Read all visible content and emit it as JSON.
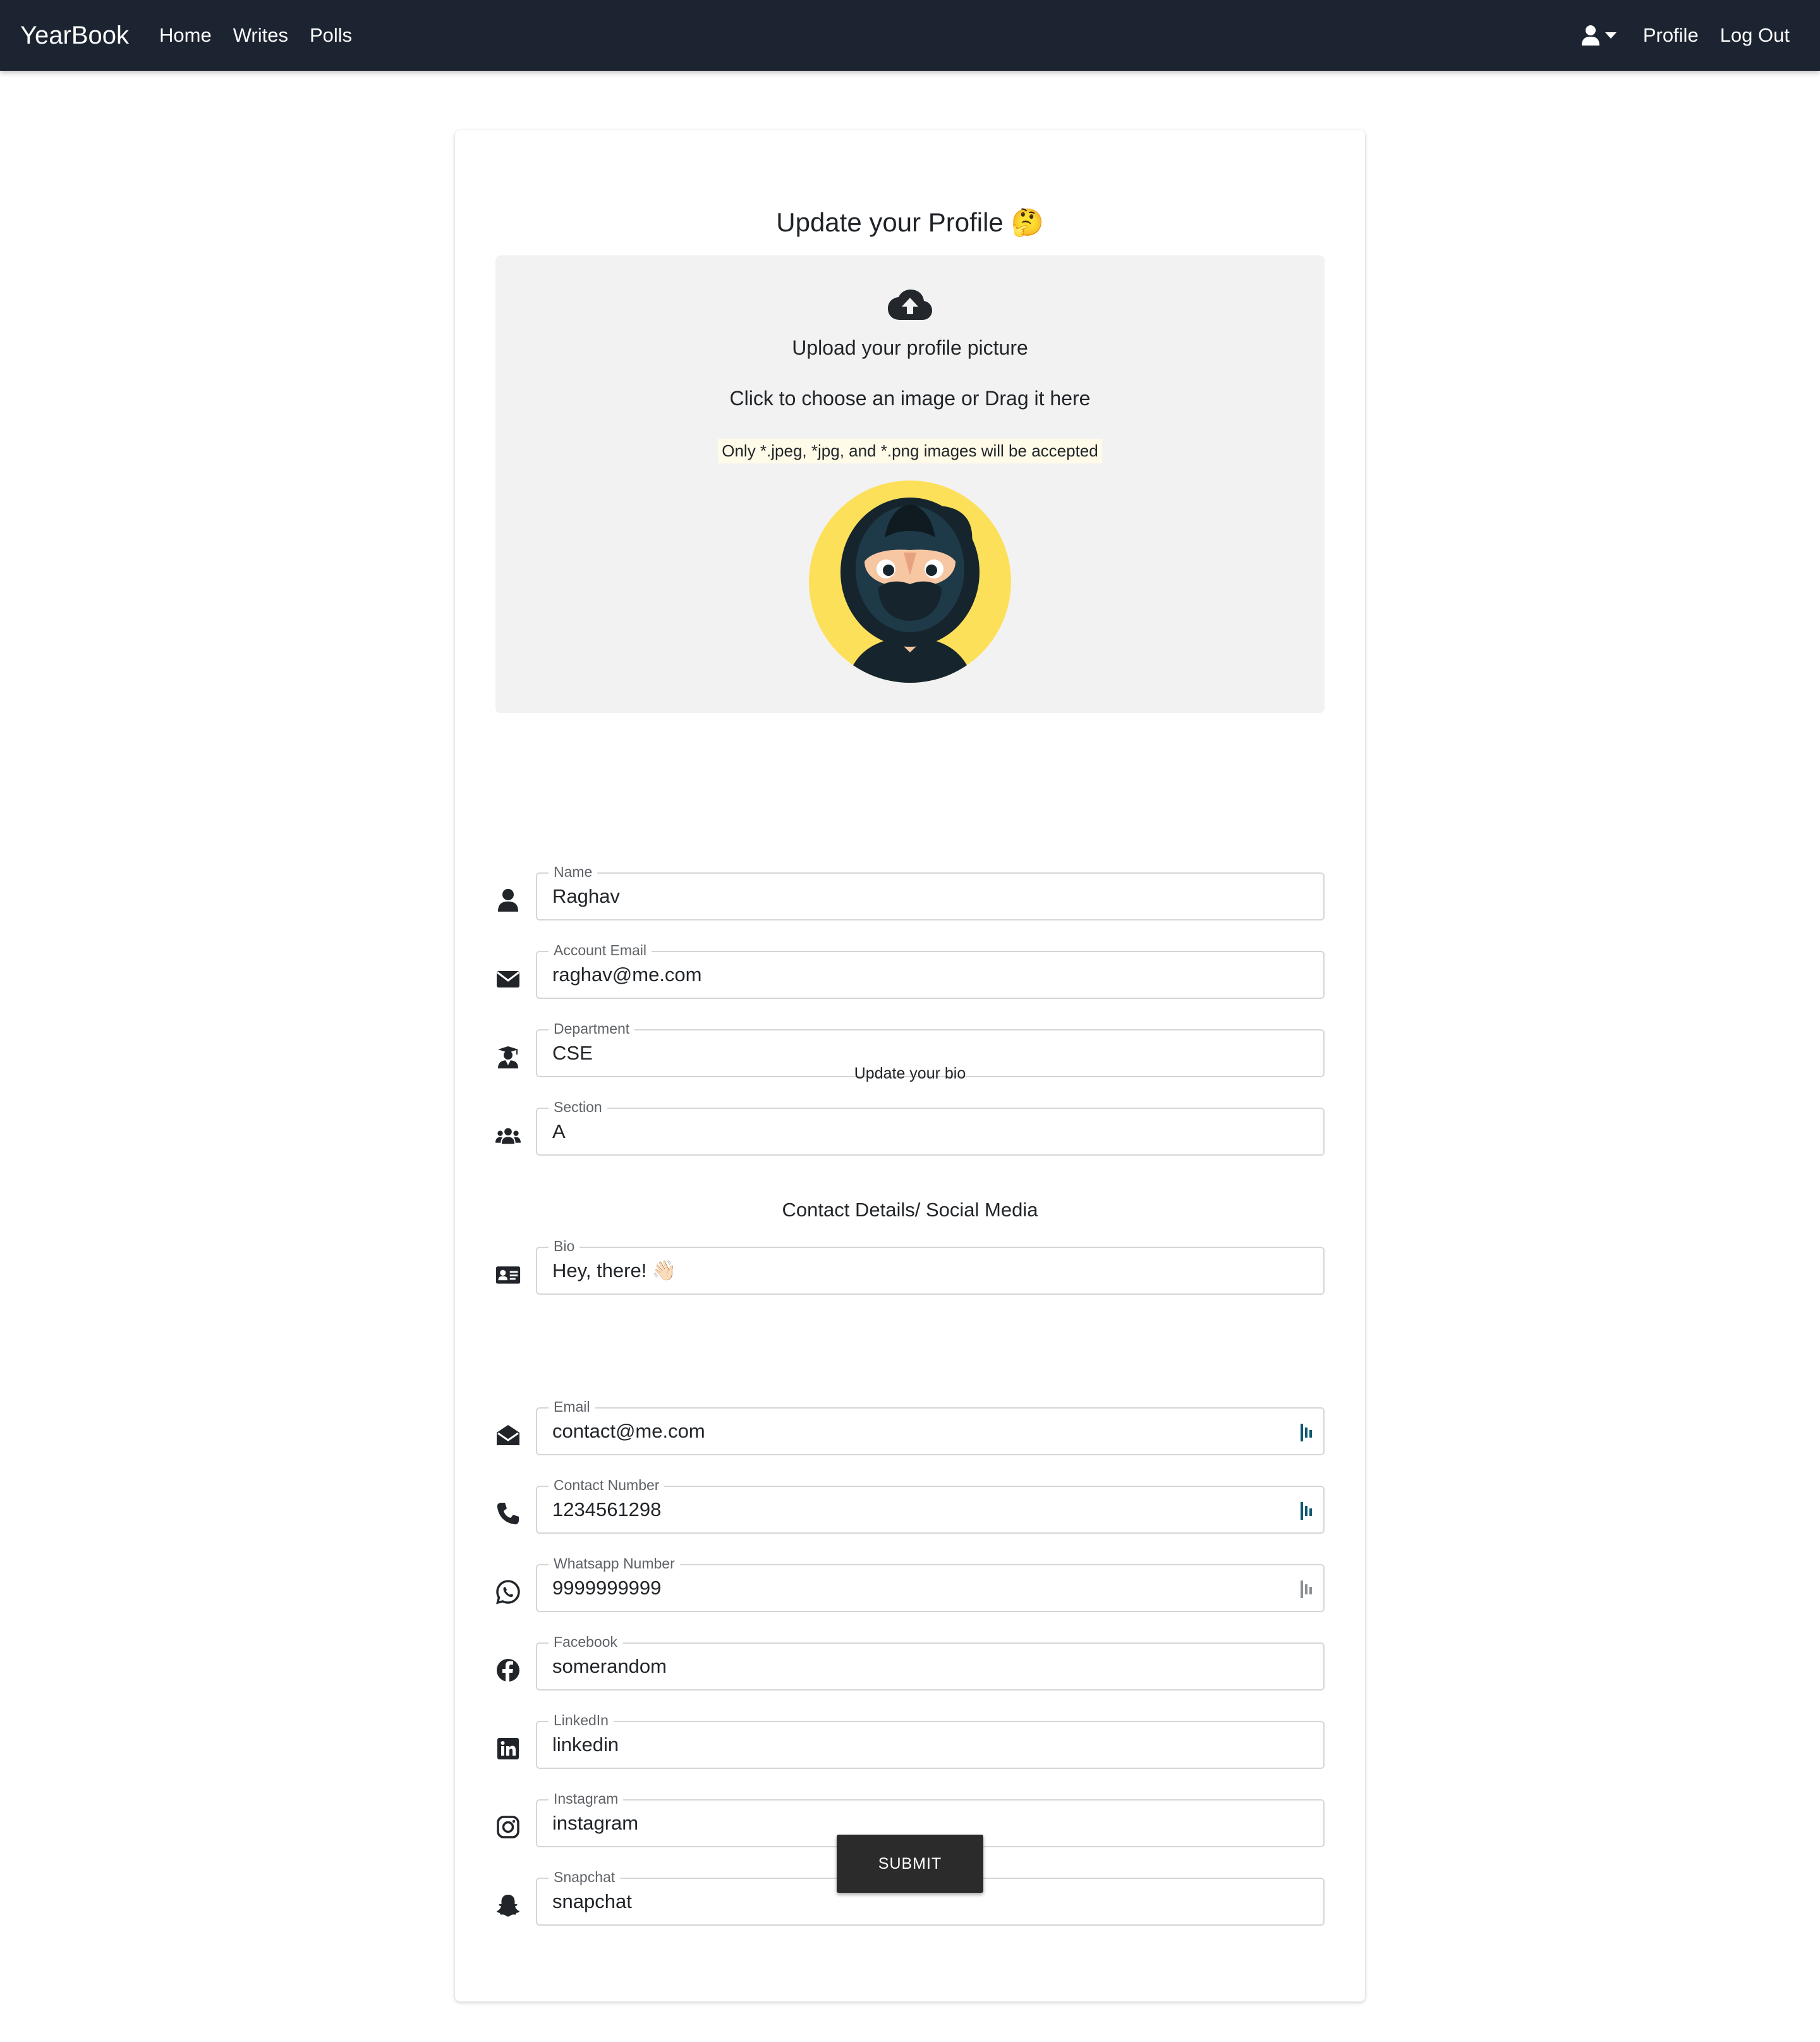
{
  "navbar": {
    "brand": "YearBook",
    "links": [
      "Home",
      "Writes",
      "Polls"
    ],
    "right_links": [
      "Profile",
      "Log Out"
    ],
    "user_icon": "user-icon"
  },
  "page": {
    "title": "Update your Profile 🤔"
  },
  "upload": {
    "icon": "cloud-upload-icon",
    "title": "Upload your profile picture",
    "subtitle": "Click to choose an image or Drag it here",
    "note": "Only *.jpeg, *jpg, and *.png images will be accepted"
  },
  "profile_fields": [
    {
      "label": "Name",
      "value": "Raghav",
      "icon": "user-icon"
    },
    {
      "label": "Account Email",
      "value": "raghav@me.com",
      "icon": "envelope-icon"
    },
    {
      "label": "Department",
      "value": "CSE",
      "icon": "graduate-icon"
    },
    {
      "label": "Section",
      "value": "A",
      "icon": "users-icon"
    }
  ],
  "bio_heading": "Update your bio",
  "bio_field": {
    "label": "Bio",
    "value": "Hey, there! 👋🏻",
    "icon": "id-card-icon"
  },
  "contact_heading": "Contact Details/ Social Media",
  "contact_fields": [
    {
      "label": "Email",
      "value": "contact@me.com",
      "icon": "envelope-open-icon"
    },
    {
      "label": "Contact Number",
      "value": "1234561298",
      "icon": "phone-icon"
    },
    {
      "label": "Whatsapp Number",
      "value": "9999999999",
      "icon": "whatsapp-icon"
    },
    {
      "label": "Facebook",
      "value": "somerandom",
      "icon": "facebook-icon"
    },
    {
      "label": "LinkedIn",
      "value": "linkedin",
      "icon": "linkedin-icon"
    },
    {
      "label": "Instagram",
      "value": "instagram",
      "icon": "instagram-icon"
    },
    {
      "label": "Snapchat",
      "value": "snapchat",
      "icon": "snapchat-icon"
    }
  ],
  "submit_label": "SUBMIT",
  "colors": {
    "navbar_bg": "#1c2431",
    "upload_bg": "#f2f2f2",
    "avatar_bg": "#fde05a",
    "button_bg": "#2b2b2b",
    "tool_icon": "#0e5a70"
  }
}
